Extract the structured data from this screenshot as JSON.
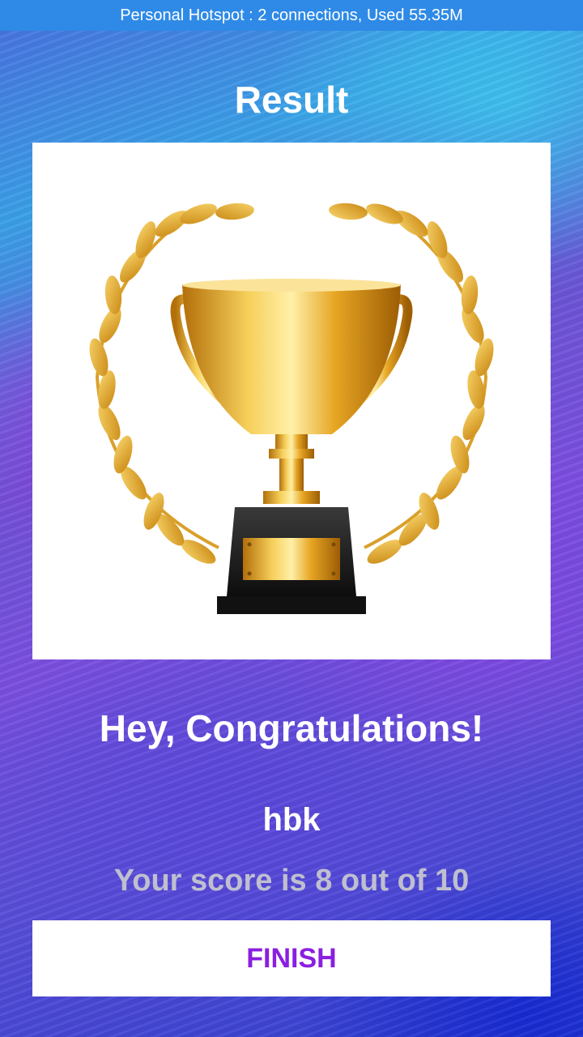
{
  "status_bar": {
    "text": "Personal Hotspot : 2 connections, Used 55.35M"
  },
  "header": {
    "title": "Result"
  },
  "result": {
    "image_icon": "trophy-with-laurel-wreath",
    "congrats": "Hey, Congratulations!",
    "user_name": "hbk",
    "score_text": "Your score is 8 out of 10",
    "score": 8,
    "total": 10
  },
  "actions": {
    "finish_label": "FINISH"
  },
  "colors": {
    "status_bar": "#2e8ae6",
    "finish_text": "#8a1fe0",
    "score_text": "#bfbfcf",
    "gold": "#e2a21b"
  }
}
